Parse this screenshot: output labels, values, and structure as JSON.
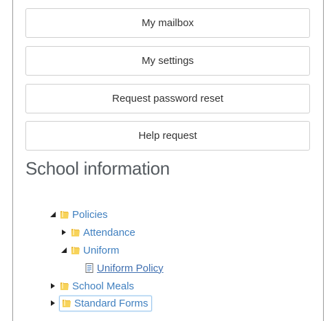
{
  "buttons": {
    "mailbox": "My mailbox",
    "settings": "My settings",
    "password_reset": "Request password reset",
    "help": "Help request"
  },
  "section": {
    "title": "School information"
  },
  "tree": {
    "policies": "Policies",
    "attendance": "Attendance",
    "uniform": "Uniform",
    "uniform_policy": "Uniform Policy",
    "school_meals": "School Meals",
    "standard_forms": "Standard Forms"
  },
  "icons": {
    "folder": "folder-icon",
    "document": "document-icon",
    "expanded": "triangle-down-icon",
    "collapsed": "triangle-right-icon"
  },
  "colors": {
    "link": "#3f7fbf",
    "heading": "#555b60",
    "focus": "#9cc7ee"
  }
}
